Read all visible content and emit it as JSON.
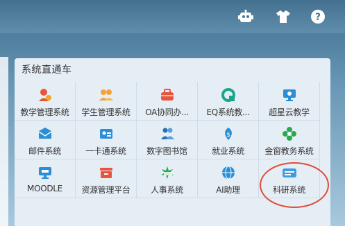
{
  "header": {
    "icons": [
      "robot-icon",
      "tshirt-icon",
      "help-icon"
    ]
  },
  "panel": {
    "title": "系统直通车",
    "items": [
      {
        "label": "教学管理系统",
        "icon": "teaching-admin-icon",
        "color": "#e8553e"
      },
      {
        "label": "学生管理系统",
        "icon": "student-admin-icon",
        "color": "#f2a33a"
      },
      {
        "label": "OA协同办...",
        "icon": "briefcase-icon",
        "color": "#e8553e"
      },
      {
        "label": "EQ系统教...",
        "icon": "eq-icon",
        "color": "#1aa68c"
      },
      {
        "label": "超星云教学",
        "icon": "monitor-icon",
        "color": "#2b8ed6"
      },
      {
        "label": "邮件系统",
        "icon": "mail-icon",
        "color": "#2b8ed6"
      },
      {
        "label": "一卡通系统",
        "icon": "id-card-icon",
        "color": "#2b8ed6"
      },
      {
        "label": "数字图书馆",
        "icon": "library-icon",
        "color": "#2b6fb6"
      },
      {
        "label": "就业系统",
        "icon": "employment-icon",
        "color": "#2b8ed6"
      },
      {
        "label": "金窗教务系统",
        "icon": "flower-icon",
        "color": "#2aa852"
      },
      {
        "label": "MOODLE",
        "icon": "moodle-icon",
        "color": "#2b8ed6"
      },
      {
        "label": "资源管理平台",
        "icon": "resource-icon",
        "color": "#e8553e"
      },
      {
        "label": "人事系统",
        "icon": "hr-icon",
        "color": "#2aa852"
      },
      {
        "label": "AI助理",
        "icon": "globe-icon",
        "color": "#2b8ed6"
      },
      {
        "label": "科研系统",
        "icon": "research-card-icon",
        "color": "#3d9be0"
      }
    ]
  },
  "colors": {
    "highlight": "#e04a3c",
    "card_bg": "#e6eef5"
  }
}
